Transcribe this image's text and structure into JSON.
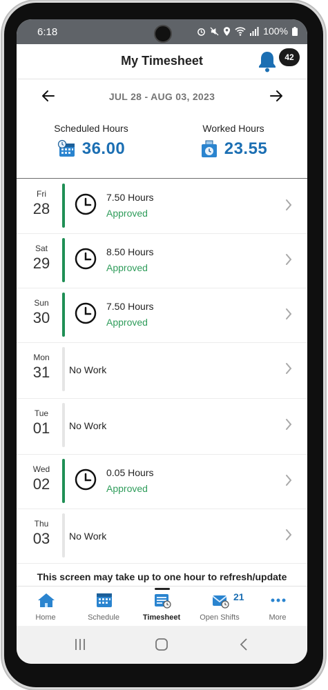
{
  "status_bar": {
    "time": "6:18",
    "battery": "100%"
  },
  "header": {
    "title": "My Timesheet",
    "notification_count": "42"
  },
  "date_range": {
    "label": "JUL 28 - AUG 03, 2023"
  },
  "summary": {
    "scheduled_label": "Scheduled Hours",
    "scheduled_value": "36.00",
    "worked_label": "Worked Hours",
    "worked_value": "23.55"
  },
  "days": [
    {
      "day": "Fri",
      "date": "28",
      "hours": "7.50 Hours",
      "status": "Approved",
      "has_work": true
    },
    {
      "day": "Sat",
      "date": "29",
      "hours": "8.50 Hours",
      "status": "Approved",
      "has_work": true
    },
    {
      "day": "Sun",
      "date": "30",
      "hours": "7.50 Hours",
      "status": "Approved",
      "has_work": true
    },
    {
      "day": "Mon",
      "date": "31",
      "text": "No Work",
      "has_work": false
    },
    {
      "day": "Tue",
      "date": "01",
      "text": "No Work",
      "has_work": false
    },
    {
      "day": "Wed",
      "date": "02",
      "hours": "0.05 Hours",
      "status": "Approved",
      "has_work": true
    },
    {
      "day": "Thu",
      "date": "03",
      "text": "No Work",
      "has_work": false
    }
  ],
  "notice": "This screen may take up to one hour to refresh/update",
  "tabs": [
    {
      "label": "Home",
      "icon": "home-icon"
    },
    {
      "label": "Schedule",
      "icon": "calendar-icon"
    },
    {
      "label": "Timesheet",
      "icon": "timesheet-icon",
      "active": true
    },
    {
      "label": "Open Shifts",
      "icon": "envelope-icon",
      "count": "21"
    },
    {
      "label": "More",
      "icon": "more-icon"
    }
  ],
  "colors": {
    "accent_blue": "#1c6fb3",
    "approved_green": "#2e9c5a",
    "bar_green": "#1f8f55",
    "bar_gray": "#e5e5e5"
  }
}
